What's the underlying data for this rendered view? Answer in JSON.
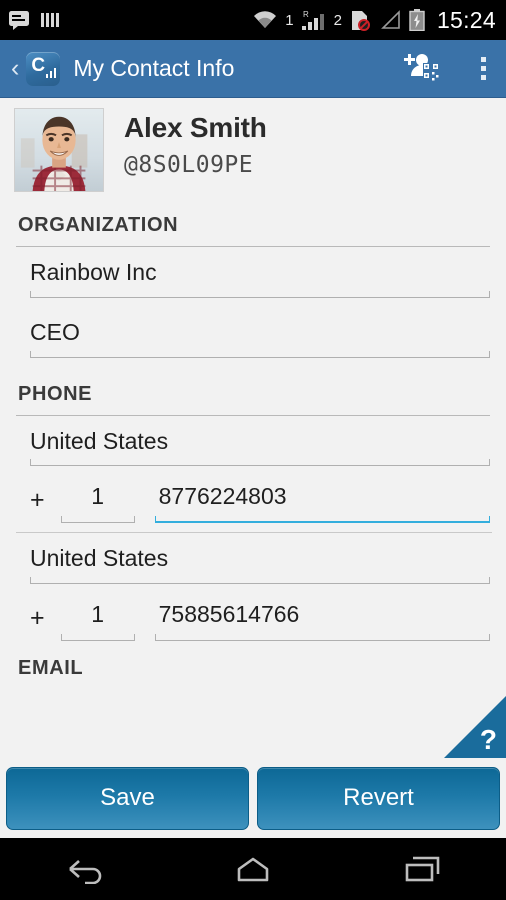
{
  "status_bar": {
    "clock": "15:24",
    "sim1_label": "1",
    "sim2_label": "2",
    "roaming_label": "R",
    "icons": [
      "message-icon",
      "signal-bars-icon",
      "wifi-icon",
      "cellular-sim1-icon",
      "sim2-no-service-icon",
      "cellular-empty-icon",
      "battery-charging-icon"
    ]
  },
  "action_bar": {
    "back_label": "‹",
    "app_icon_letter": "C",
    "title": "My Contact Info",
    "add_qr_contact_label": "add-contact-qr",
    "overflow_label": "more-options"
  },
  "profile": {
    "name": "Alex Smith",
    "handle": "@8S0L09PE"
  },
  "sections": {
    "organization": {
      "header": "ORGANIZATION",
      "fields": [
        {
          "name": "company",
          "value": "Rainbow Inc",
          "focused": false
        },
        {
          "name": "title",
          "value": "CEO",
          "focused": false
        }
      ]
    },
    "phone": {
      "header": "PHONE",
      "plus": "+",
      "entries": [
        {
          "country": "United States",
          "country_code": "1",
          "number": "8776224803",
          "number_focused": true
        },
        {
          "country": "United States",
          "country_code": "1",
          "number": "75885614766",
          "number_focused": false
        }
      ]
    },
    "email": {
      "header": "EMAIL"
    }
  },
  "help": {
    "label": "?"
  },
  "buttons": {
    "save": "Save",
    "revert": "Revert"
  },
  "nav_bar": {
    "back": "back-icon",
    "home": "home-icon",
    "recents": "recents-icon"
  },
  "colors": {
    "action_bar": "#3a72a8",
    "accent_focus": "#33aedd",
    "button_blue": "#1d79a8",
    "help_tab": "#1a6c9c",
    "content_bg": "#f2f2f2"
  }
}
